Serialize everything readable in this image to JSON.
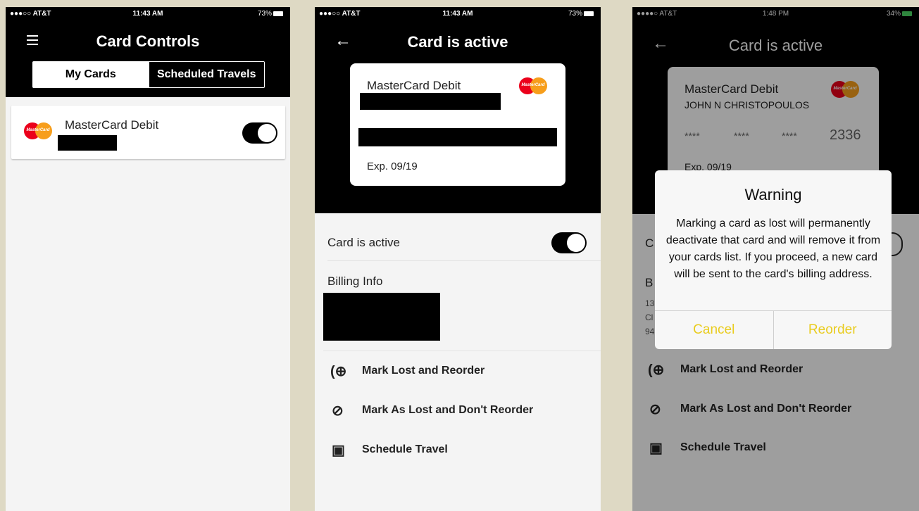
{
  "screen1": {
    "status": {
      "carrier": "●●●○○ AT&T",
      "time": "11:43 AM",
      "battery": "73%"
    },
    "title": "Card Controls",
    "tabs": [
      "My Cards",
      "Scheduled Travels"
    ],
    "card": {
      "name": "MasterCard Debit",
      "logo_text": "MasterCard",
      "active": true
    }
  },
  "screen2": {
    "status": {
      "carrier": "●●●○○ AT&T",
      "time": "11:43 AM",
      "battery": "73%"
    },
    "title": "Card is active",
    "card": {
      "name": "MasterCard Debit",
      "logo_text": "MasterCard",
      "exp": "Exp. 09/19"
    },
    "toggle_label": "Card is active",
    "billing_label": "Billing Info",
    "actions": [
      {
        "icon": "add-circle-icon",
        "label": "Mark Lost and Reorder"
      },
      {
        "icon": "block-icon",
        "label": "Mark As Lost and Don't Reorder"
      },
      {
        "icon": "calendar-icon",
        "label": "Schedule Travel"
      }
    ]
  },
  "screen3": {
    "status": {
      "carrier": "●●●●○ AT&T",
      "time": "1:48 PM",
      "battery": "34%"
    },
    "title": "Card is active",
    "card": {
      "name": "MasterCard Debit",
      "holder": "JOHN N CHRISTOPOULOS",
      "masked": [
        "****",
        "****",
        "****"
      ],
      "last4": "2336",
      "exp": "Exp. 09/19",
      "logo_text": "MasterCard"
    },
    "partial_rows": {
      "toggle_initial": "C",
      "billing_initial": "B",
      "addr1": "13",
      "addr2": "Cl",
      "addr3": "94"
    },
    "dialog": {
      "title": "Warning",
      "message": "Marking a card as lost will permanently deactivate that card and will remove it from your cards list. If you proceed, a new card will be sent to the card's billing address.",
      "cancel": "Cancel",
      "reorder": "Reorder"
    },
    "actions": [
      {
        "icon": "add-circle-icon",
        "label": "Mark Lost and Reorder"
      },
      {
        "icon": "block-icon",
        "label": "Mark As Lost and Don't Reorder"
      },
      {
        "icon": "calendar-icon",
        "label": "Schedule Travel"
      }
    ]
  },
  "colors": {
    "accent_yellow": "#e9cc1e",
    "mc_red": "#eb001b",
    "mc_orange": "#f79e1b",
    "header": "#000000"
  }
}
